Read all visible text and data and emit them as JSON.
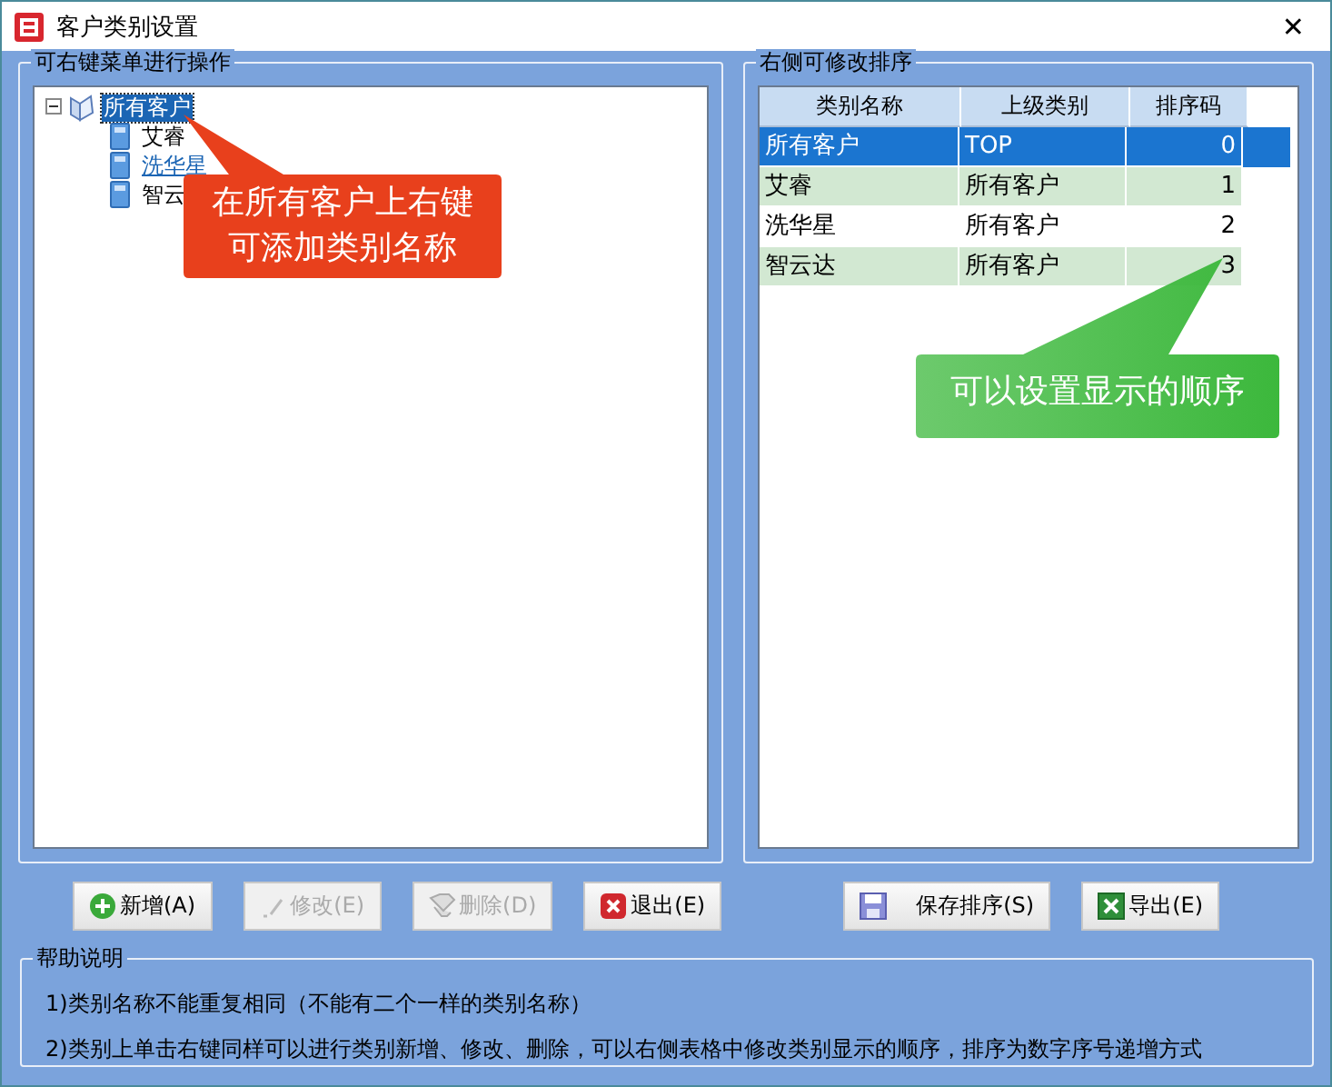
{
  "window": {
    "title": "客户类别设置",
    "close": "✕"
  },
  "tree_panel": {
    "title": "可右键菜单进行操作",
    "tree": [
      {
        "label": "所有客户",
        "expanded": true,
        "selected": true,
        "hover": false,
        "children": [
          {
            "label": "艾睿",
            "selected": false,
            "hover": false
          },
          {
            "label": "洗华星",
            "selected": false,
            "hover": true
          },
          {
            "label": "智云",
            "selected": false,
            "hover": false
          }
        ]
      }
    ]
  },
  "sort_panel": {
    "title": "右侧可修改排序",
    "columns": [
      "类别名称",
      "上级类别",
      "排序码"
    ],
    "rows": [
      {
        "cells": [
          "所有客户",
          "TOP",
          "0"
        ],
        "selected": true
      },
      {
        "cells": [
          "艾睿",
          "所有客户",
          "1"
        ],
        "selected": false
      },
      {
        "cells": [
          "洗华星",
          "所有客户",
          "2"
        ],
        "selected": false
      },
      {
        "cells": [
          "智云达",
          "所有客户",
          "3"
        ],
        "selected": false
      }
    ]
  },
  "buttons": [
    {
      "label": "新增(A)",
      "kind": "add",
      "disabled": false
    },
    {
      "label": "修改(E)",
      "kind": "edit",
      "disabled": true
    },
    {
      "label": "删除(D)",
      "kind": "delete",
      "disabled": true
    },
    {
      "label": "退出(E)",
      "kind": "exit",
      "disabled": false
    },
    {
      "label": "保存排序(S)",
      "kind": "save",
      "disabled": false
    },
    {
      "label": "导出(E)",
      "kind": "export",
      "disabled": false
    }
  ],
  "help": {
    "title": "帮助说明",
    "lines": [
      "1)类别名称不能重复相同（不能有二个一样的类别名称）",
      "2)类别上单击右键同样可以进行类别新增、修改、删除，可以右侧表格中修改类别显示的顺序，排序为数字序号递增方式"
    ]
  },
  "callouts": [
    {
      "lines": [
        "在所有客户上右键",
        "可添加类别名称"
      ],
      "color": "#e8401c"
    },
    {
      "lines": [
        "可以设置显示的顺序"
      ],
      "color": "#3cb83c"
    }
  ]
}
